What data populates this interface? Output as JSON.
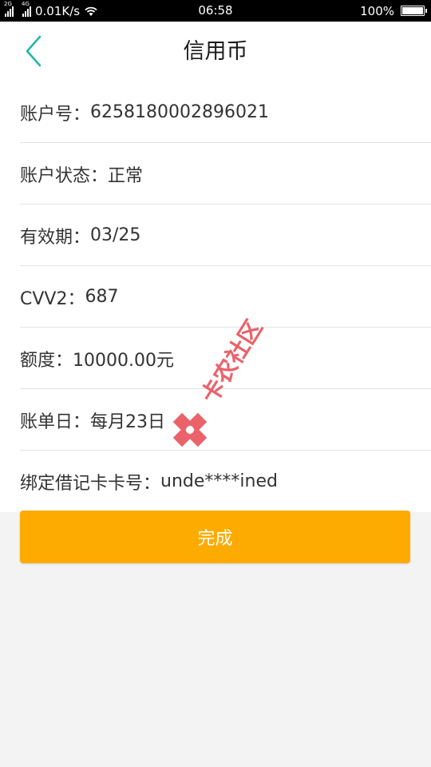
{
  "status_bar": {
    "net1": "2G",
    "net2": "4G",
    "speed": "0.01K/s",
    "time": "06:58",
    "battery": "100%"
  },
  "header": {
    "title": "信用币",
    "back_icon": "chevron-left-icon"
  },
  "details": [
    {
      "label": "账户号：",
      "value": "6258180002896021"
    },
    {
      "label": "账户状态：",
      "value": "正常"
    },
    {
      "label": "有效期：",
      "value": "03/25"
    },
    {
      "label": "CVV2：",
      "value": "687"
    },
    {
      "label": "额度：",
      "value": "10000.00元"
    },
    {
      "label": "账单日：",
      "value": "每月23日"
    },
    {
      "label": "绑定借记卡卡号：",
      "value": "unde****ined"
    }
  ],
  "done_label": "完成",
  "watermark": {
    "text": "卡农社区",
    "icon": "kanong-logo-icon"
  },
  "colors": {
    "accent_back": "#1fb6a9",
    "button": "#fdab00",
    "watermark": "#e8525a"
  }
}
